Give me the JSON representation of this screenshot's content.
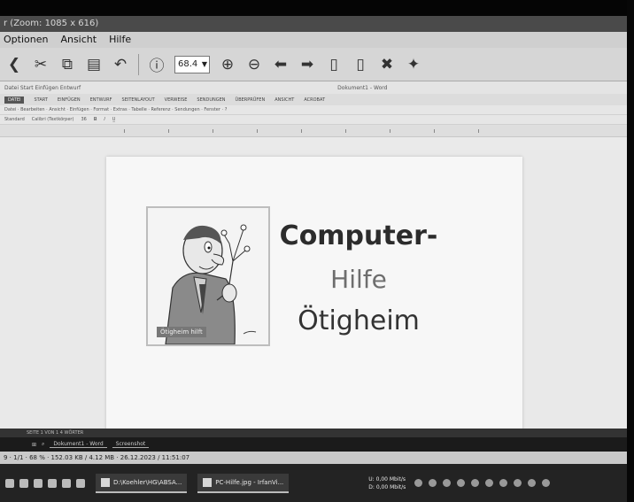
{
  "irfanview": {
    "title": "r (Zoom: 1085 x 616)",
    "menu": [
      "Optionen",
      "Ansicht",
      "Hilfe"
    ],
    "zoom_value": "68.4",
    "status": "9 · 1/1 · 68 % · 152.03 KB / 4.12 MB · 26.12.2023 / 11:51:07"
  },
  "word": {
    "title_left": "Datei  Start  Einfügen  Entwurf",
    "doc_title": "Dokument1 - Word",
    "tabs": [
      "DATEI",
      "START",
      "EINFÜGEN",
      "ENTWURF",
      "SEITENLAYOUT",
      "VERWEISE",
      "SENDUNGEN",
      "ÜBERPRÜFEN",
      "ANSICHT",
      "ACROBAT"
    ],
    "menubar": "Datei · Bearbeiten · Ansicht · Einfügen · Format · Extras · Tabelle · Referenz · Sendungen · Fenster · ?",
    "style_box": "Standard",
    "font_box": "Calibri (Textkörper)",
    "font_size": "36",
    "page": {
      "line1": "Computer-",
      "line2": "Hilfe",
      "line3": "Ötigheim",
      "photo_caption": "Ötigheim hilft"
    },
    "status": "SEITE 1 VON 1   4 WÖRTER"
  },
  "inner_taskbar": {
    "apps": [
      "Dokument1 - Word",
      "Screenshot"
    ]
  },
  "taskbar": {
    "tasks": [
      "D:\\Koehler\\HG\\ABSA...",
      "PC-Hilfe.jpg - IrfanVi..."
    ],
    "net": [
      "U: 0,00 Mbit/s",
      "D: 0,00 Mbit/s"
    ]
  }
}
